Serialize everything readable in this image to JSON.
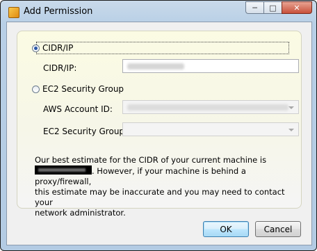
{
  "window": {
    "title": "Add Permission"
  },
  "titlebar_buttons": {
    "minimize": "─",
    "maximize": "□",
    "close": "✕"
  },
  "options": {
    "cidr": {
      "label": "CIDR/IP",
      "selected": true
    },
    "ec2": {
      "label": "EC2 Security Group",
      "selected": false
    }
  },
  "fields": {
    "cidr_ip": {
      "label": "CIDR/IP:"
    },
    "aws_account_id": {
      "label": "AWS Account ID:"
    },
    "ec2_security_group": {
      "label": "EC2 Security Group:"
    }
  },
  "info": {
    "line1": "Our best estimate for the CIDR of your current machine is",
    "line2_suffix": ". However, if your machine is behind a proxy/firewall,",
    "line3": "this estimate may be inaccurate and you may need to contact your",
    "line4": "network administrator."
  },
  "buttons": {
    "ok": "OK",
    "cancel": "Cancel"
  }
}
